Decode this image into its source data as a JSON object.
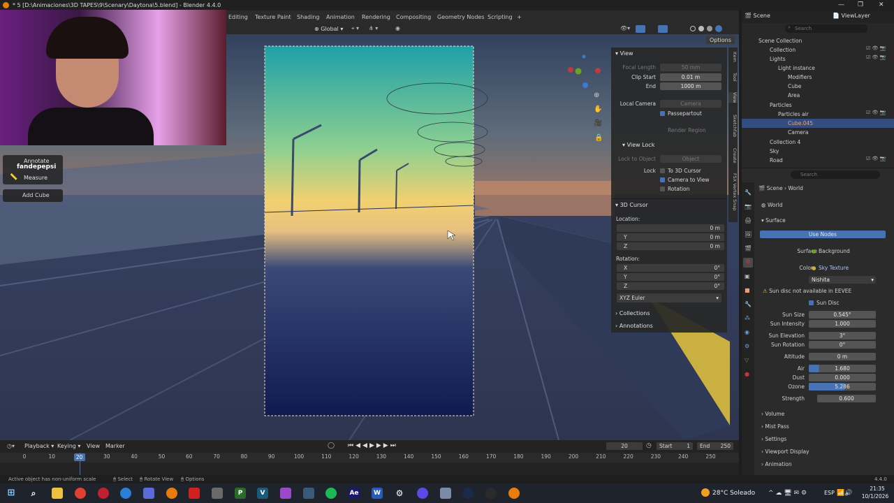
{
  "window": {
    "title": "* 5 [D:\\Animaciones\\3D TAPES\\9\\Scenary\\Daytona\\5.blend] - Blender 4.4.0"
  },
  "workspaces": [
    "Editing",
    "Texture Paint",
    "Shading",
    "Animation",
    "Rendering",
    "Compositing",
    "Geometry Nodes",
    "Scripting",
    "+"
  ],
  "viewport_header": {
    "orientation": "Global",
    "options_label": "Options"
  },
  "overlay": {
    "username": "fandepepsi",
    "tools": [
      "Annotate",
      "Measure"
    ],
    "last_op": "Add Cube"
  },
  "npanel": {
    "view_header": "View",
    "focal_length_label": "Focal Length",
    "focal_length": "50 mm",
    "clip_start_label": "Clip Start",
    "clip_start": "0.01 m",
    "end_label": "End",
    "end": "1000 m",
    "local_camera_label": "Local Camera",
    "camera_label": "Camera",
    "passepartout": "Passepartout",
    "render_region": "Render Region",
    "view_lock_header": "View Lock",
    "lock_to_object_label": "Lock to Object",
    "object_placeholder": "Object",
    "lock_label": "Lock",
    "to_3d_cursor": "To 3D Cursor",
    "camera_to_view": "Camera to View",
    "rotation_chk": "Rotation",
    "cursor_header": "3D Cursor",
    "location_label": "Location:",
    "loc_x": "0 m",
    "loc_y": "0 m",
    "loc_z": "0 m",
    "rotation_label": "Rotation:",
    "rot_x": "0°",
    "rot_y": "0°",
    "rot_z": "0°",
    "rotation_mode": "XYZ Euler",
    "collections": "Collections",
    "annotations": "Annotations",
    "axis_x": "X",
    "axis_y": "Y",
    "axis_z": "Z"
  },
  "vtabs": [
    "Item",
    "Tool",
    "View",
    "Sketchfab",
    "Create",
    "FSX Vertex Snap"
  ],
  "outliner": {
    "scene": "Scene",
    "view_layer": "ViewLayer",
    "search_placeholder": "Search",
    "rows": [
      {
        "label": "Scene Collection",
        "indent": 0
      },
      {
        "label": "Collection",
        "indent": 1
      },
      {
        "label": "Lights",
        "indent": 1
      },
      {
        "label": "Light instance",
        "indent": 2
      },
      {
        "label": "Modifiers",
        "indent": 3
      },
      {
        "label": "Cube",
        "indent": 3
      },
      {
        "label": "Area",
        "indent": 2
      },
      {
        "label": "Particles",
        "indent": 1
      },
      {
        "label": "Particles air",
        "indent": 2
      },
      {
        "label": "Cube.045",
        "indent": 3
      },
      {
        "label": "Camera",
        "indent": 2
      },
      {
        "label": "Collection 4",
        "indent": 1
      },
      {
        "label": "Sky",
        "indent": 1
      },
      {
        "label": "Road",
        "indent": 1
      }
    ]
  },
  "properties": {
    "search_placeholder": "Search",
    "breadcrumb_scene": "Scene",
    "breadcrumb_world": "World",
    "world_name": "World",
    "surface": "Surface",
    "use_nodes": "Use Nodes",
    "surface_label": "Surface",
    "surface_value": "Background",
    "color_label": "Color",
    "color_value": "Sky Texture",
    "sky_type": "Nishita",
    "warning": "Sun disc not available in EEVEE",
    "sun_disc": "Sun Disc",
    "sun_size_label": "Sun Size",
    "sun_size": "0.545°",
    "sun_intensity_label": "Sun Intensity",
    "sun_intensity": "1.000",
    "sun_elevation_label": "Sun Elevation",
    "sun_elevation": "3°",
    "sun_rotation_label": "Sun Rotation",
    "sun_rotation": "0°",
    "altitude_label": "Altitude",
    "altitude": "0 m",
    "air_label": "Air",
    "air": "1.680",
    "dust_label": "Dust",
    "dust": "0.000",
    "ozone_label": "Ozone",
    "ozone": "5.286",
    "strength_label": "Strength",
    "strength": "0.600",
    "sections": [
      "Volume",
      "Mist Pass",
      "Settings",
      "Viewport Display",
      "Animation"
    ]
  },
  "timeline": {
    "playback": "Playback",
    "keying": "Keying",
    "view": "View",
    "marker": "Marker",
    "current_frame": "20",
    "start_label": "Start",
    "start": "1",
    "end_label": "End",
    "end": "250",
    "ticks": [
      "0",
      "10",
      "20",
      "30",
      "40",
      "50",
      "60",
      "70",
      "80",
      "90",
      "100",
      "110",
      "120",
      "130",
      "140",
      "150",
      "160",
      "170",
      "180",
      "190",
      "200",
      "210",
      "220",
      "230",
      "240",
      "250"
    ]
  },
  "status": {
    "message": "Active object has non-uniform scale",
    "select": "Select",
    "rotate_view": "Rotate View",
    "options": "Options",
    "version": "4.4.0"
  },
  "taskbar": {
    "weather": "28°C Soleado",
    "lang": "ESP",
    "time": "21:35",
    "date": "10/1/2026"
  },
  "colors": {
    "accent": "#4772b3",
    "blender_orange": "#e87d0d",
    "selection": "#334d80"
  }
}
